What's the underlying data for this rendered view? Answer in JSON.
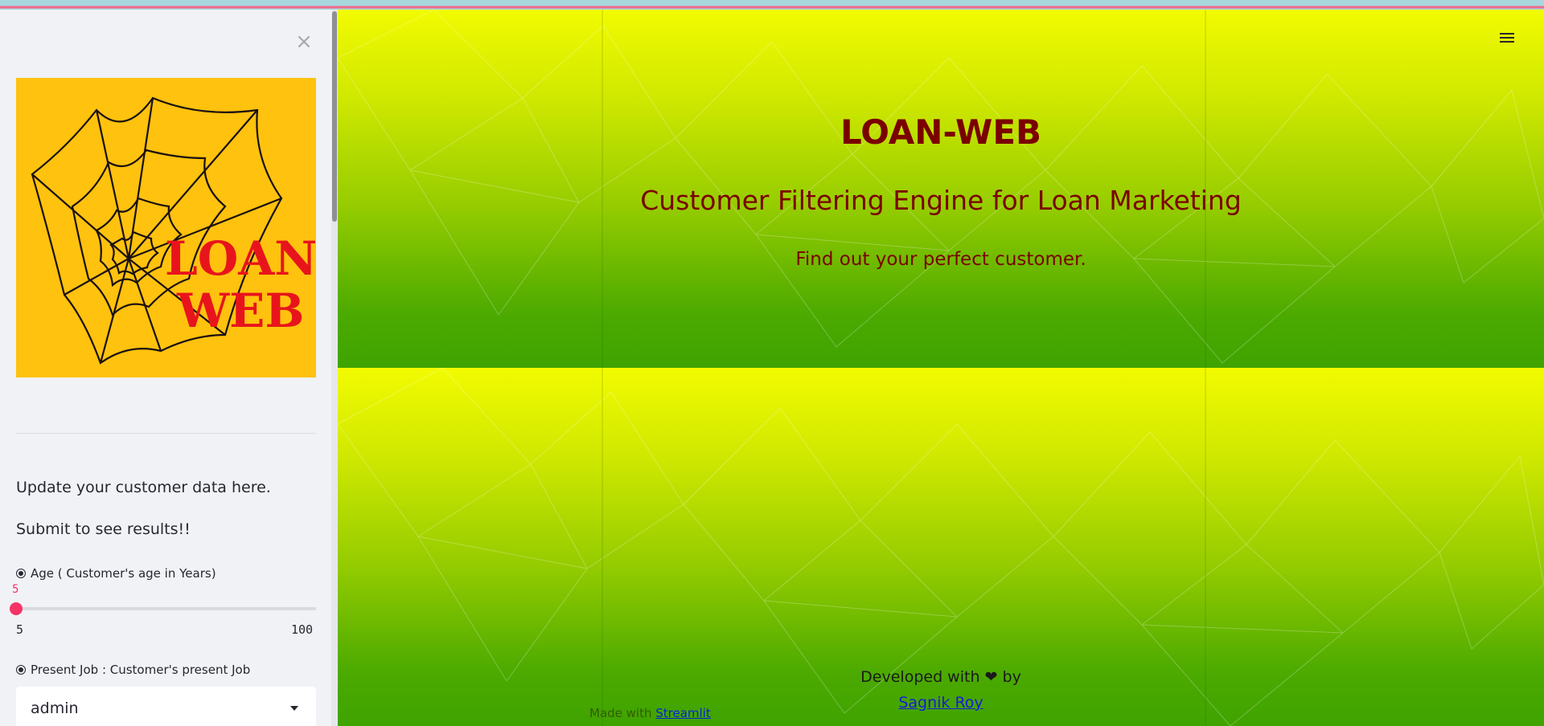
{
  "sidebar": {
    "close_label": "×",
    "logo_text_line1": "LOAN",
    "logo_text_line2": "WEB",
    "intro_text": "Update your customer data here.",
    "submit_text": "Submit to see results!!",
    "age_label": "Age ( Customer's age in Years)",
    "age_value": "5",
    "age_min": "5",
    "age_max": "100",
    "age_fraction": 0,
    "job_label": "Present Job : Customer's present Job",
    "job_selected": "admin"
  },
  "main": {
    "title": "LOAN-WEB",
    "subtitle": "Customer Filtering Engine for Loan Marketing",
    "tagline": "Find out your perfect customer.",
    "footer_prefix": "Developed with",
    "footer_heart": "❤",
    "footer_suffix": "by",
    "author": "Sagnik Roy",
    "made_with_prefix": "Made with",
    "made_with_link": "Streamlit"
  },
  "colors": {
    "accent": "#f63366",
    "title_color": "#7a0000",
    "logo_background": "#ffc20e",
    "logo_text": "#e8141c"
  },
  "icons": {
    "close": "close-icon",
    "menu": "hamburger-menu-icon",
    "dropdown": "chevron-down-icon",
    "radio": "radio-icon"
  }
}
